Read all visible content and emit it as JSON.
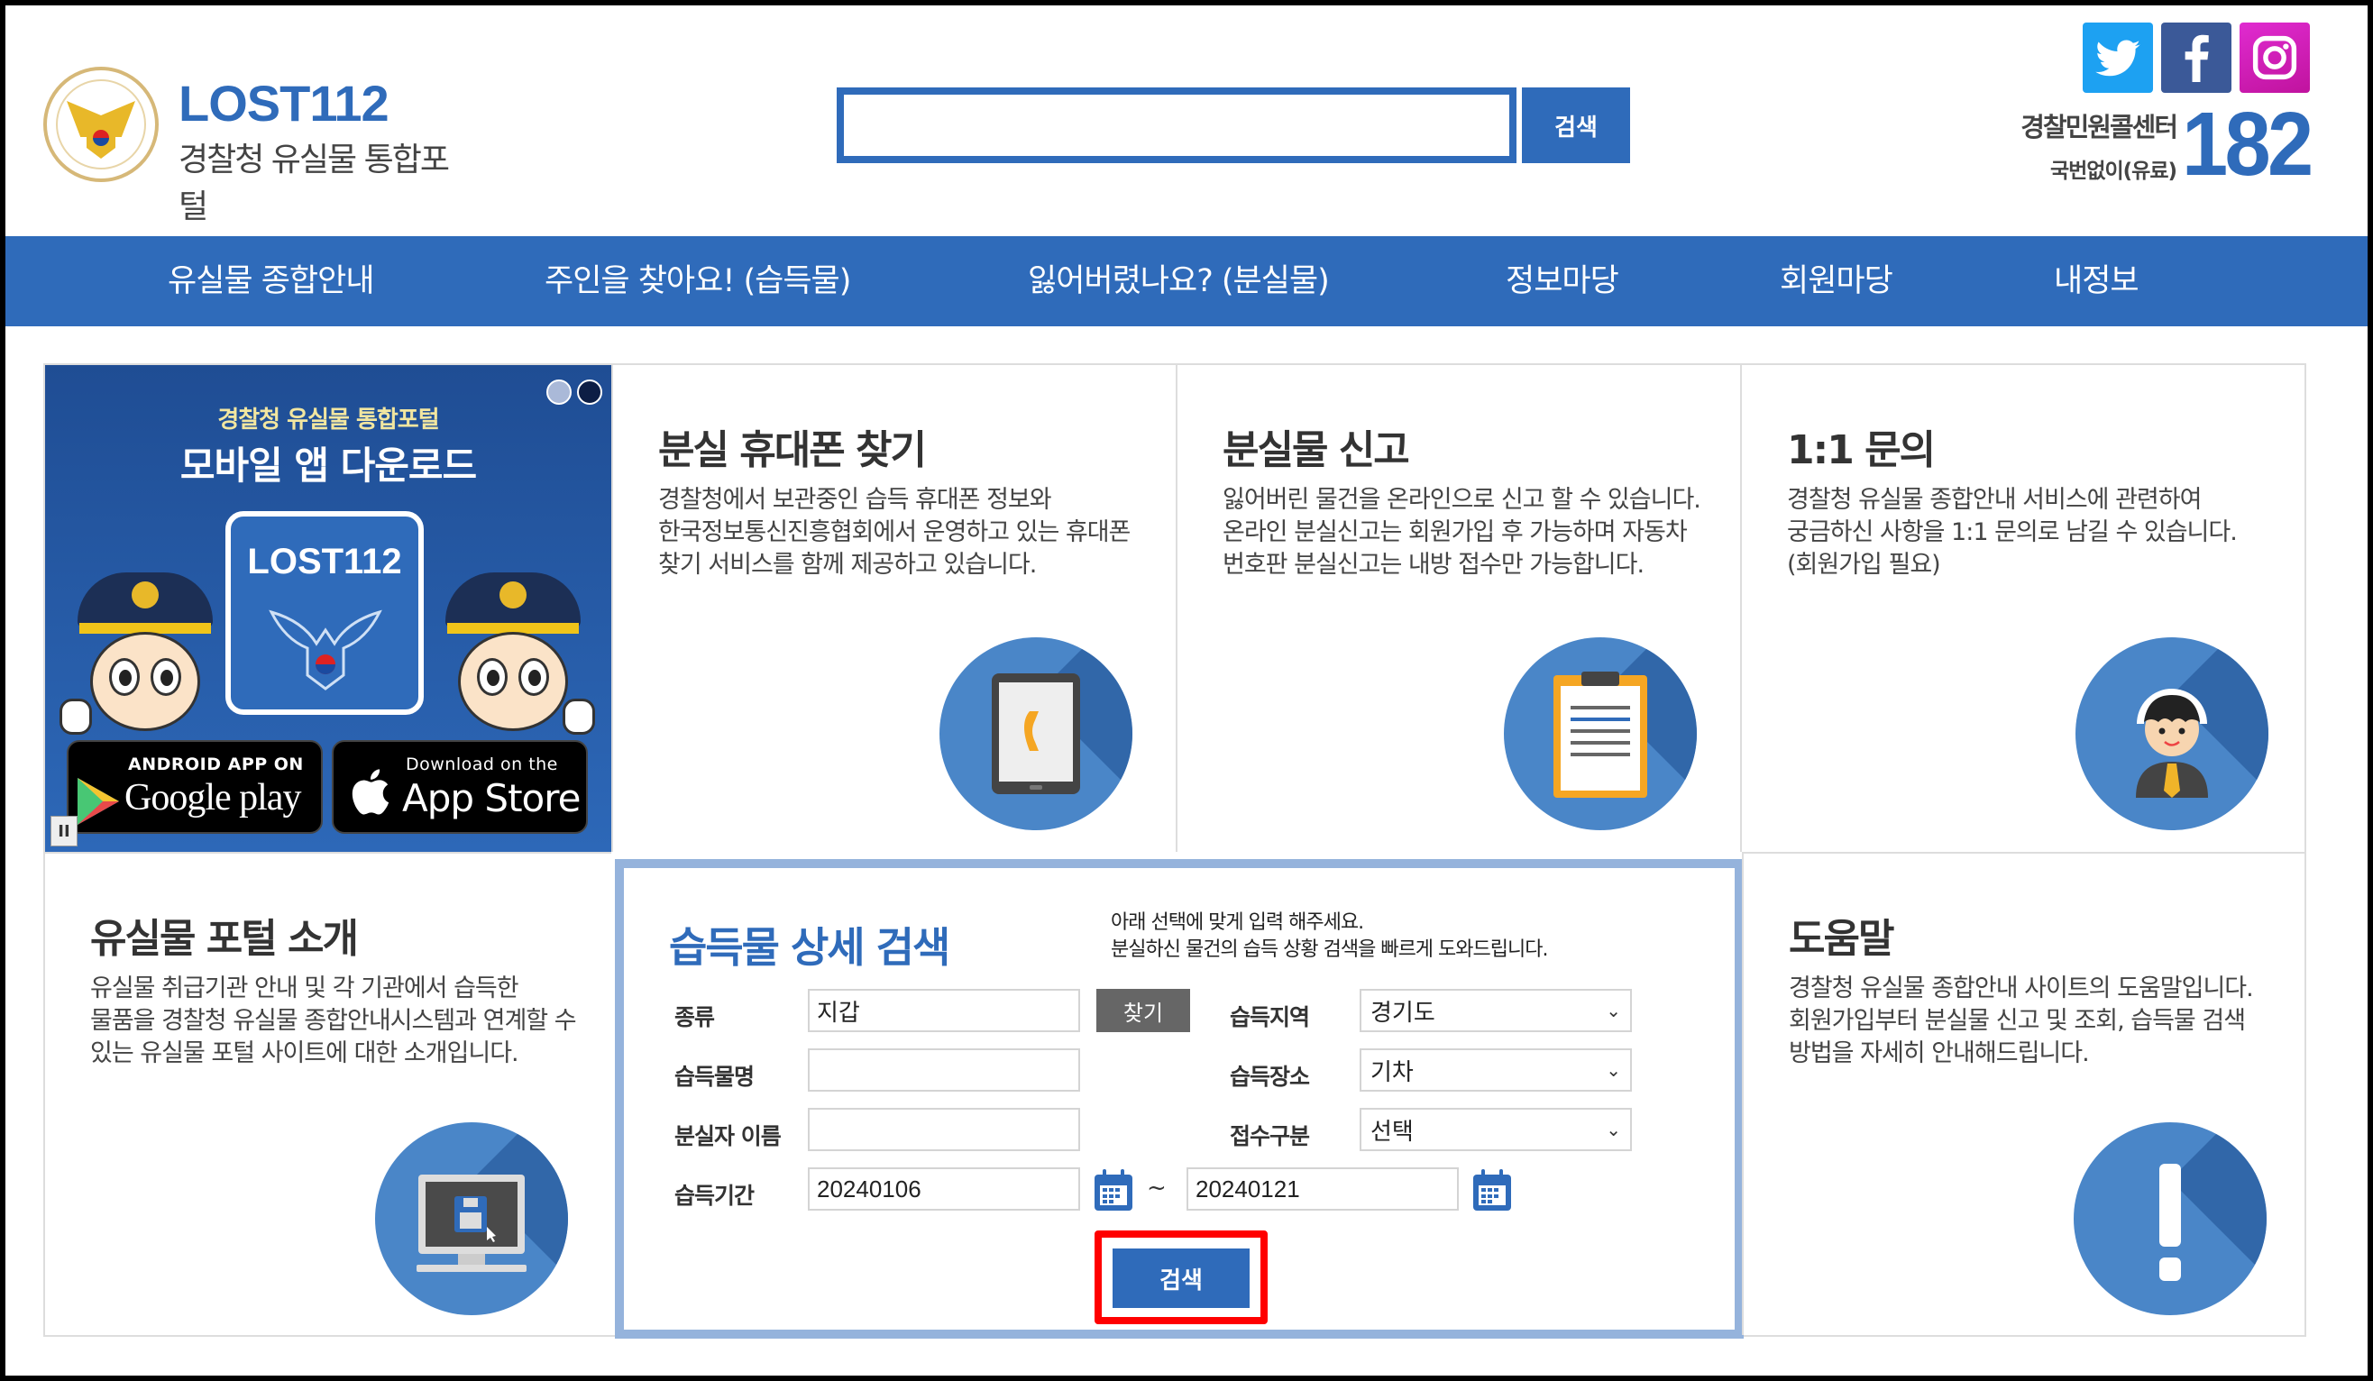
{
  "header": {
    "logo_title": "LOST112",
    "logo_subtitle": "경찰청 유실물 통합포털",
    "search_value": "",
    "search_button": "검색",
    "social": [
      "twitter",
      "facebook",
      "instagram"
    ],
    "callcenter_label": "경찰민원콜센터",
    "callcenter_note": "국번없이(유료)",
    "callcenter_number": "182"
  },
  "nav": {
    "items": [
      "유실물 종합안내",
      "주인을 찾아요! (습득물)",
      "잃어버렸나요? (분실물)",
      "정보마당",
      "회원마당",
      "내정보"
    ]
  },
  "banner": {
    "subtitle": "경찰청 유실물 통합포털",
    "title": "모바일 앱 다운로드",
    "app_label": "LOST112",
    "google_line1": "ANDROID APP ON",
    "google_line2": "Google play",
    "apple_line1": "Download on the",
    "apple_line2": "App Store",
    "slide_count": 2,
    "active_slide": 2,
    "pause_label": "II"
  },
  "cards": [
    {
      "title": "분실 휴대폰 찾기",
      "text": "경찰청에서 보관중인 습득 휴대폰 정보와 한국정보통신진흥협회에서 운영하고 있는 휴대폰 찾기 서비스를 함께 제공하고 있습니다.",
      "icon": "phone-icon"
    },
    {
      "title": "분실물 신고",
      "text": "잃어버린 물건을 온라인으로 신고 할 수 있습니다. 온라인 분실신고는 회원가입 후 가능하며 자동차 번호판 분실신고는 내방 접수만 가능합니다.",
      "icon": "clipboard-icon"
    },
    {
      "title": "1:1 문의",
      "text": "경찰청 유실물 종합안내 서비스에 관련하여 궁금하신 사항을 1:1 문의로 남길 수 있습니다. (회원가입 필요)",
      "icon": "operator-icon"
    },
    {
      "title": "유실물 포털 소개",
      "text": "유실물 취급기관 안내 및 각 기관에서 습득한 물품을 경찰청 유실물 종합안내시스템과 연계할 수 있는 유실물 포털 사이트에 대한 소개입니다.",
      "icon": "computer-icon"
    },
    {
      "title": "도움말",
      "text": "경찰청 유실물 종합안내 사이트의 도움말입니다. 회원가입부터 분실물 신고 및 조회, 습득물 검색 방법을 자세히 안내해드립니다.",
      "icon": "exclamation-icon"
    }
  ],
  "search_form": {
    "title": "습득물 상세 검색",
    "desc_line1": "아래 선택에 맞게 입력 해주세요.",
    "desc_line2": "분실하신 물건의 습득 상황 검색을 빠르게 도와드립니다.",
    "category_label": "종류",
    "category_value": "지갑",
    "find_button": "찾기",
    "item_name_label": "습득물명",
    "item_name_value": "",
    "owner_name_label": "분실자 이름",
    "owner_name_value": "",
    "period_label": "습득기간",
    "start_date": "20240106",
    "period_sep": "~",
    "end_date": "20240121",
    "region_label": "습득지역",
    "region_value": "경기도",
    "place_label": "습득장소",
    "place_value": "기차",
    "receipt_label": "접수구분",
    "receipt_value": "선택",
    "submit_button": "검색",
    "highlight_color": "#ff0000"
  },
  "colors": {
    "brand_blue": "#2f6bba",
    "panel_border": "#95b3dc",
    "find_button": "#666666"
  }
}
